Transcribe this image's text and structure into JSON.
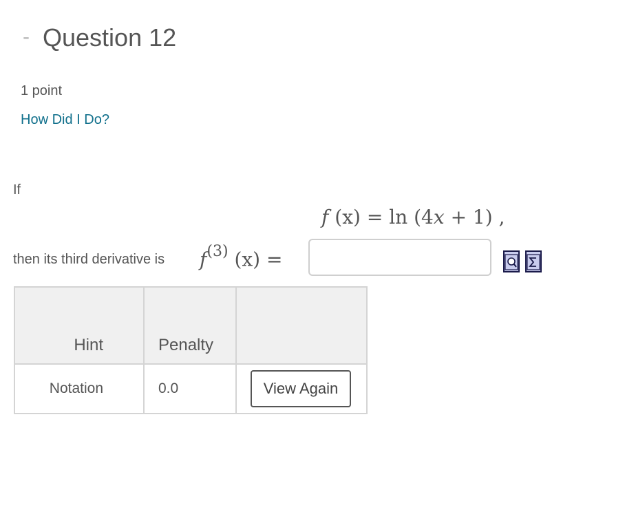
{
  "question": {
    "collapse_dash": "-",
    "title": "Question 12",
    "points": "1 point",
    "how_link": "How Did I Do?"
  },
  "problem": {
    "if_text": "If",
    "function_f": "f",
    "function_x": "(x)",
    "function_eq": "=",
    "function_rhs_ln": "ln",
    "function_rhs_arg_open": "(4",
    "function_rhs_arg_x": "x",
    "function_rhs_arg_close": "+ 1)",
    "function_comma": ",",
    "then_text": "then its third derivative is",
    "deriv_f": "f",
    "deriv_order": "(3)",
    "deriv_x": "(x)",
    "deriv_eq": "=",
    "answer_value": ""
  },
  "toolbar": {
    "preview_icon": "magnifier-preview-icon",
    "equation_icon": "sigma-equation-icon",
    "button_color": "#c9ccee"
  },
  "hints_table": {
    "headers": [
      "Hint",
      "Penalty",
      ""
    ],
    "rows": [
      {
        "hint": "Notation",
        "penalty": "0.0",
        "action": "View Again"
      }
    ]
  },
  "colors": {
    "link": "#11708c",
    "text": "#555555",
    "header_bg": "#f0f0f0",
    "border": "#d4d4d4"
  }
}
